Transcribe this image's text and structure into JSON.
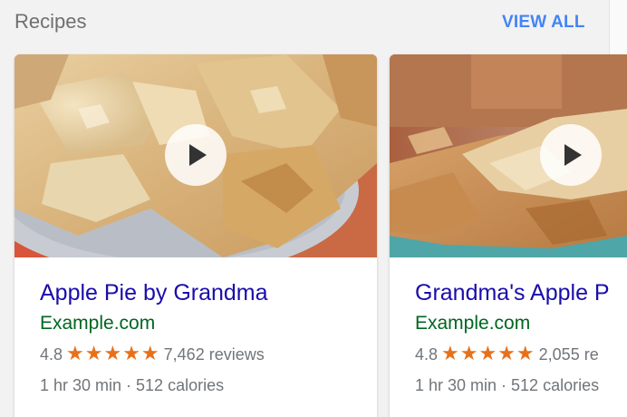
{
  "header": {
    "title": "Recipes",
    "view_all_label": "VIEW ALL"
  },
  "cards": [
    {
      "title": "Apple Pie by Grandma",
      "source": "Example.com",
      "rating": "4.8",
      "stars": "★★★★★",
      "reviews": "7,462 reviews",
      "meta": "1 hr 30 min · 512 calories"
    },
    {
      "title": "Grandma's Apple P",
      "source": "Example.com",
      "rating": "4.8",
      "stars": "★★★★★",
      "reviews": "2,055 re",
      "meta": "1 hr 30 min · 512 calories"
    }
  ],
  "colors": {
    "accent": "#4285f4",
    "title_link": "#1a0dab",
    "source": "#006621",
    "star": "#e7711b",
    "muted": "#70757a"
  },
  "icons": {
    "play": "play-icon",
    "star": "star-icon"
  }
}
